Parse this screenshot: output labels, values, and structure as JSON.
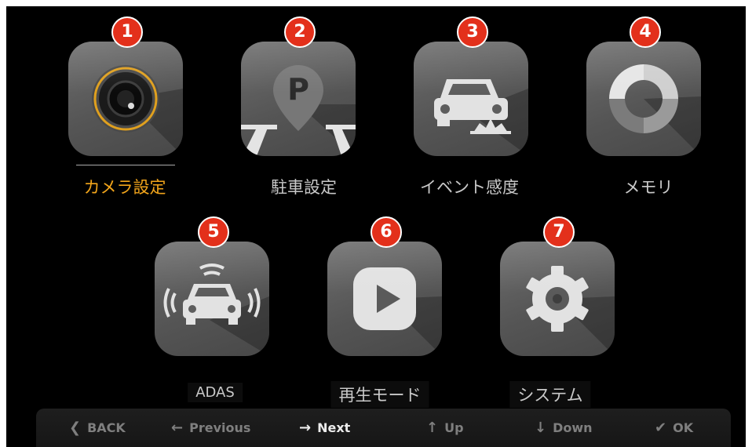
{
  "apps": [
    {
      "number": "1",
      "label": "カメラ設定",
      "icon": "camera-lens-icon",
      "selected": true
    },
    {
      "number": "2",
      "label": "駐車設定",
      "icon": "parking-icon",
      "selected": false
    },
    {
      "number": "3",
      "label": "イベント感度",
      "icon": "car-impact-icon",
      "selected": false
    },
    {
      "number": "4",
      "label": "メモリ",
      "icon": "memory-donut-icon",
      "selected": false
    },
    {
      "number": "5",
      "label": "ADAS",
      "icon": "car-sensor-icon",
      "selected": false
    },
    {
      "number": "6",
      "label": "再生モード",
      "icon": "play-icon",
      "selected": false
    },
    {
      "number": "7",
      "label": "システム",
      "icon": "gear-icon",
      "selected": false
    }
  ],
  "hints": [
    {
      "label": "BACK",
      "glyph": "❮",
      "icon": "chevron-left-icon"
    },
    {
      "label": "Previous",
      "glyph": "←",
      "icon": "arrow-left-icon"
    },
    {
      "label": "Next",
      "glyph": "→",
      "icon": "arrow-right-icon",
      "active": true
    },
    {
      "label": "Up",
      "glyph": "↑",
      "icon": "arrow-up-icon"
    },
    {
      "label": "Down",
      "glyph": "↓",
      "icon": "arrow-down-icon"
    },
    {
      "label": "OK",
      "glyph": "✔",
      "icon": "check-icon"
    }
  ],
  "colors": {
    "selected_label": "#f2a51b",
    "badge": "#e3301b",
    "tile": "#5a5a5a",
    "accent_ring": "#e0a01e"
  }
}
